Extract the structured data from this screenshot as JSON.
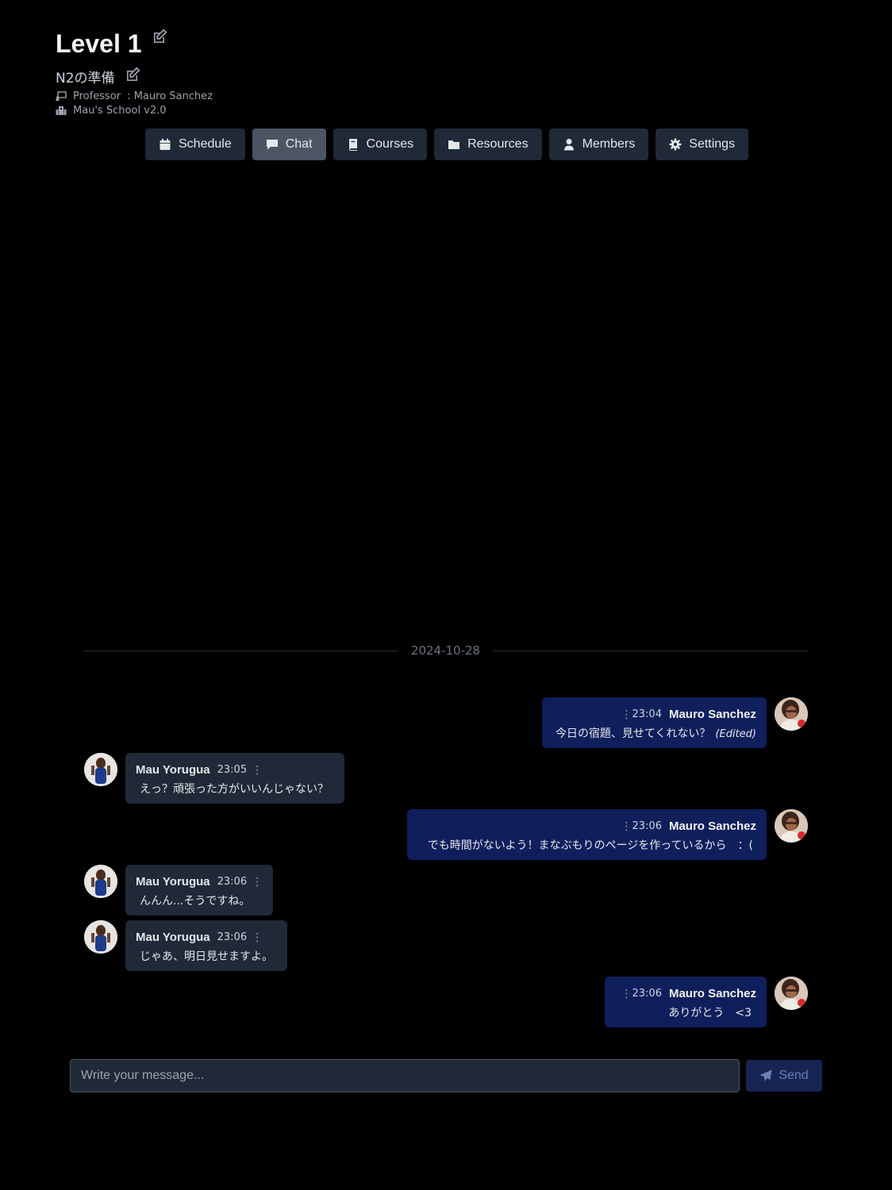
{
  "header": {
    "title": "Level 1",
    "subtitle": "N2の準備",
    "professor_label": "Professor ",
    "professor_name": ": Mauro Sanchez",
    "school": "Mau's School v2.0"
  },
  "tabs": [
    {
      "label": "Schedule",
      "icon": "calendar-icon"
    },
    {
      "label": "Chat",
      "icon": "chat-icon",
      "active": true
    },
    {
      "label": "Courses",
      "icon": "book-icon"
    },
    {
      "label": "Resources",
      "icon": "folder-icon"
    },
    {
      "label": "Members",
      "icon": "user-icon"
    },
    {
      "label": "Settings",
      "icon": "gear-icon"
    }
  ],
  "chat": {
    "date": "2024-10-28",
    "messages": [
      {
        "side": "out",
        "author": "Mauro Sanchez",
        "time": "23:04",
        "text": "今日の宿題、見せてくれない？",
        "edited": "(Edited)"
      },
      {
        "side": "in",
        "author": "Mau Yorugua",
        "time": "23:05",
        "text": "えっ？頑張った方がいいんじゃない？"
      },
      {
        "side": "out",
        "author": "Mauro Sanchez",
        "time": "23:06",
        "text": "でも時間がないよう！まなぶもりのページを作っているから　：("
      },
      {
        "side": "in",
        "author": "Mau Yorugua",
        "time": "23:06",
        "text": "んんん...そうですね。"
      },
      {
        "side": "in",
        "author": "Mau Yorugua",
        "time": "23:06",
        "text": "じゃあ、明日見せますよ。"
      },
      {
        "side": "out",
        "author": "Mauro Sanchez",
        "time": "23:06",
        "text": "ありがとう　<3"
      }
    ]
  },
  "composer": {
    "placeholder": "Write your message...",
    "send_label": "Send"
  },
  "colors": {
    "background": "#000000",
    "outgoing_bubble": "#0f1f5c",
    "incoming_bubble": "#1f2937",
    "tab": "#1f2937",
    "tab_active": "#4b5563",
    "send_button": "#172554"
  }
}
